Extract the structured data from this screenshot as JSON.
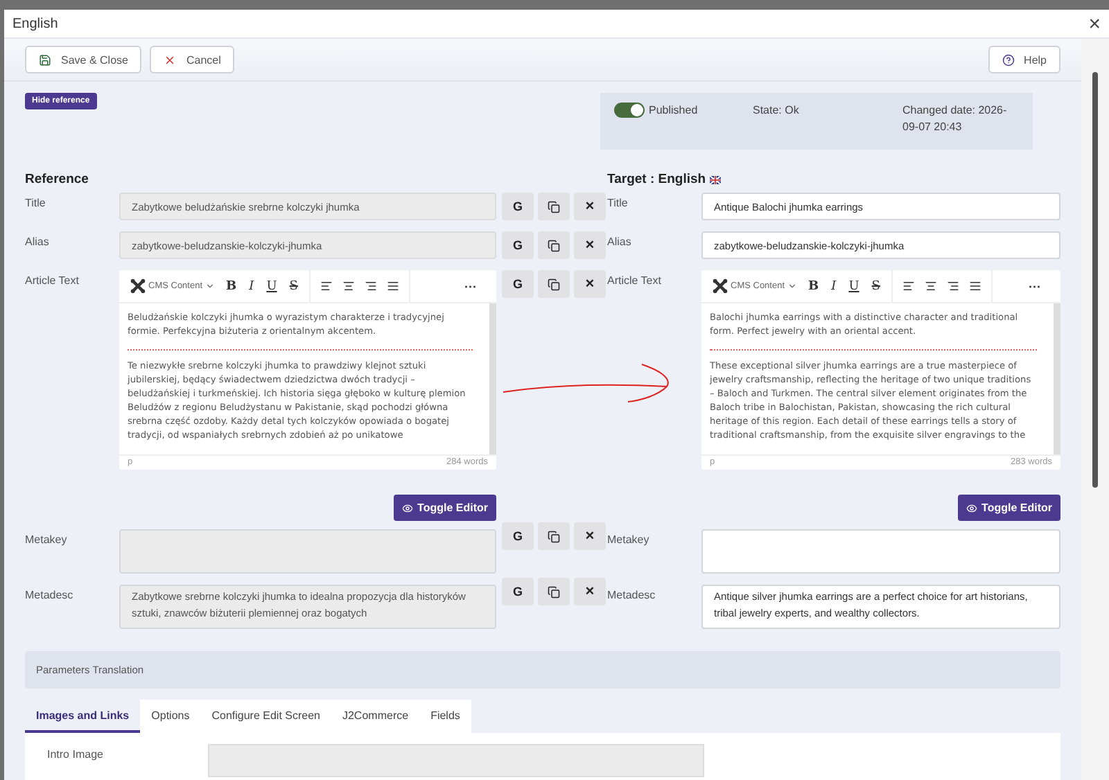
{
  "window": {
    "title": "English",
    "close": "×"
  },
  "toolbar": [
    {
      "kind": "save",
      "label": "Save & Close"
    },
    {
      "kind": "cancel",
      "label": "Cancel"
    },
    {
      "kind": "help",
      "label": "Help"
    }
  ],
  "hide_reference": "Hide reference",
  "status": {
    "published": {
      "label": "Published",
      "on": true
    },
    "state": "State: Ok",
    "changed": "Changed date: 2026-09-07 20:43"
  },
  "reference": {
    "heading": "Reference",
    "fields": [
      {
        "kind": "input",
        "label": "Title",
        "value": "Zabytkowe beludżańskie srebrne kolczyki jhumka",
        "actions": [
          {
            "kind": "translate",
            "label": "G"
          },
          {
            "kind": "copy"
          },
          {
            "kind": "clear",
            "label": "×"
          }
        ]
      },
      {
        "kind": "input",
        "label": "Alias",
        "value": "zabytkowe-beludzanskie-kolczyki-jhumka",
        "actions": [
          {
            "kind": "translate",
            "label": "G"
          },
          {
            "kind": "copy"
          },
          {
            "kind": "clear",
            "label": "×"
          }
        ]
      },
      {
        "kind": "editor",
        "label": "Article Text",
        "toolbar": {
          "format": "CMS Content",
          "buttons": [
            "B",
            "I",
            "U",
            "S"
          ],
          "more": "···"
        },
        "paragraphs": [
          "Beludżańskie kolczyki jhumka o wyrazistym charakterze i tradycyjnej formie. Perfekcyjna biżuteria z orientalnym akcentem.",
          "Te niezwykłe srebrne kolczyki jhumka to prawdziwy klejnot sztuki jubilerskiej, będący świadectwem dziedzictwa dwóch tradycji – beludżańskiej i turkmeńskiej. Ich historia sięga głęboko w kulturę plemion Beludżów z regionu Beludżystanu w Pakistanie, skąd pochodzi główna srebrna część ozdoby. Każdy detal tych kolczyków opowiada o bogatej tradycji, od wspaniałych srebrnych zdobień aż po unikatowe"
        ],
        "path": "p",
        "words": "284 words",
        "toggle": "Toggle Editor",
        "actions": [
          {
            "kind": "translate",
            "label": "G"
          },
          {
            "kind": "copy"
          },
          {
            "kind": "clear",
            "label": "×"
          }
        ]
      },
      {
        "kind": "textarea",
        "label": "Metakey",
        "actions": [
          {
            "kind": "translate",
            "label": "G"
          },
          {
            "kind": "copy"
          },
          {
            "kind": "clear",
            "label": "×"
          }
        ]
      },
      {
        "kind": "textarea",
        "label": "Metadesc",
        "value": "Zabytkowe srebrne kolczyki jhumka to idealna propozycja dla historyków sztuki, znawców biżuterii plemiennej oraz bogatych",
        "actions": [
          {
            "kind": "translate",
            "label": "G"
          },
          {
            "kind": "copy"
          },
          {
            "kind": "clear",
            "label": "×"
          }
        ]
      }
    ]
  },
  "target": {
    "heading": "Target : English",
    "fields": [
      {
        "kind": "input",
        "label": "Title",
        "value": "Antique Balochi jhumka earrings"
      },
      {
        "kind": "input",
        "label": "Alias",
        "value": "zabytkowe-beludzanskie-kolczyki-jhumka"
      },
      {
        "kind": "editor",
        "label": "Article Text",
        "toolbar": {
          "format": "CMS Content",
          "buttons": [
            "B",
            "I",
            "U",
            "S"
          ],
          "more": "···"
        },
        "paragraphs": [
          "Balochi jhumka earrings with a distinctive character and traditional form. Perfect jewelry with an oriental accent.",
          "These exceptional silver jhumka earrings are a true masterpiece of jewelry craftsmanship, reflecting the heritage of two unique traditions – Baloch and Turkmen. The central silver element originates from the Baloch tribe in Balochistan, Pakistan, showcasing the rich cultural heritage of this region. Each detail of these earrings tells a story of traditional craftsmanship, from the exquisite silver engravings to the"
        ],
        "path": "p",
        "words": "283 words",
        "toggle": "Toggle Editor"
      },
      {
        "kind": "textarea",
        "label": "Metakey"
      },
      {
        "kind": "textarea",
        "label": "Metadesc",
        "value": "Antique silver jhumka earrings are a perfect choice for art historians, tribal jewelry experts, and wealthy collectors."
      }
    ]
  },
  "parameters": {
    "title": "Parameters Translation",
    "tabs": [
      {
        "label": "Images and Links",
        "selected": true
      },
      {
        "label": "Options",
        "selected": false
      },
      {
        "label": "Configure Edit Screen",
        "selected": false
      },
      {
        "label": "J2Commerce",
        "selected": false
      },
      {
        "label": "Fields",
        "selected": false
      }
    ],
    "fields": [
      {
        "label": "Intro Image"
      }
    ]
  }
}
